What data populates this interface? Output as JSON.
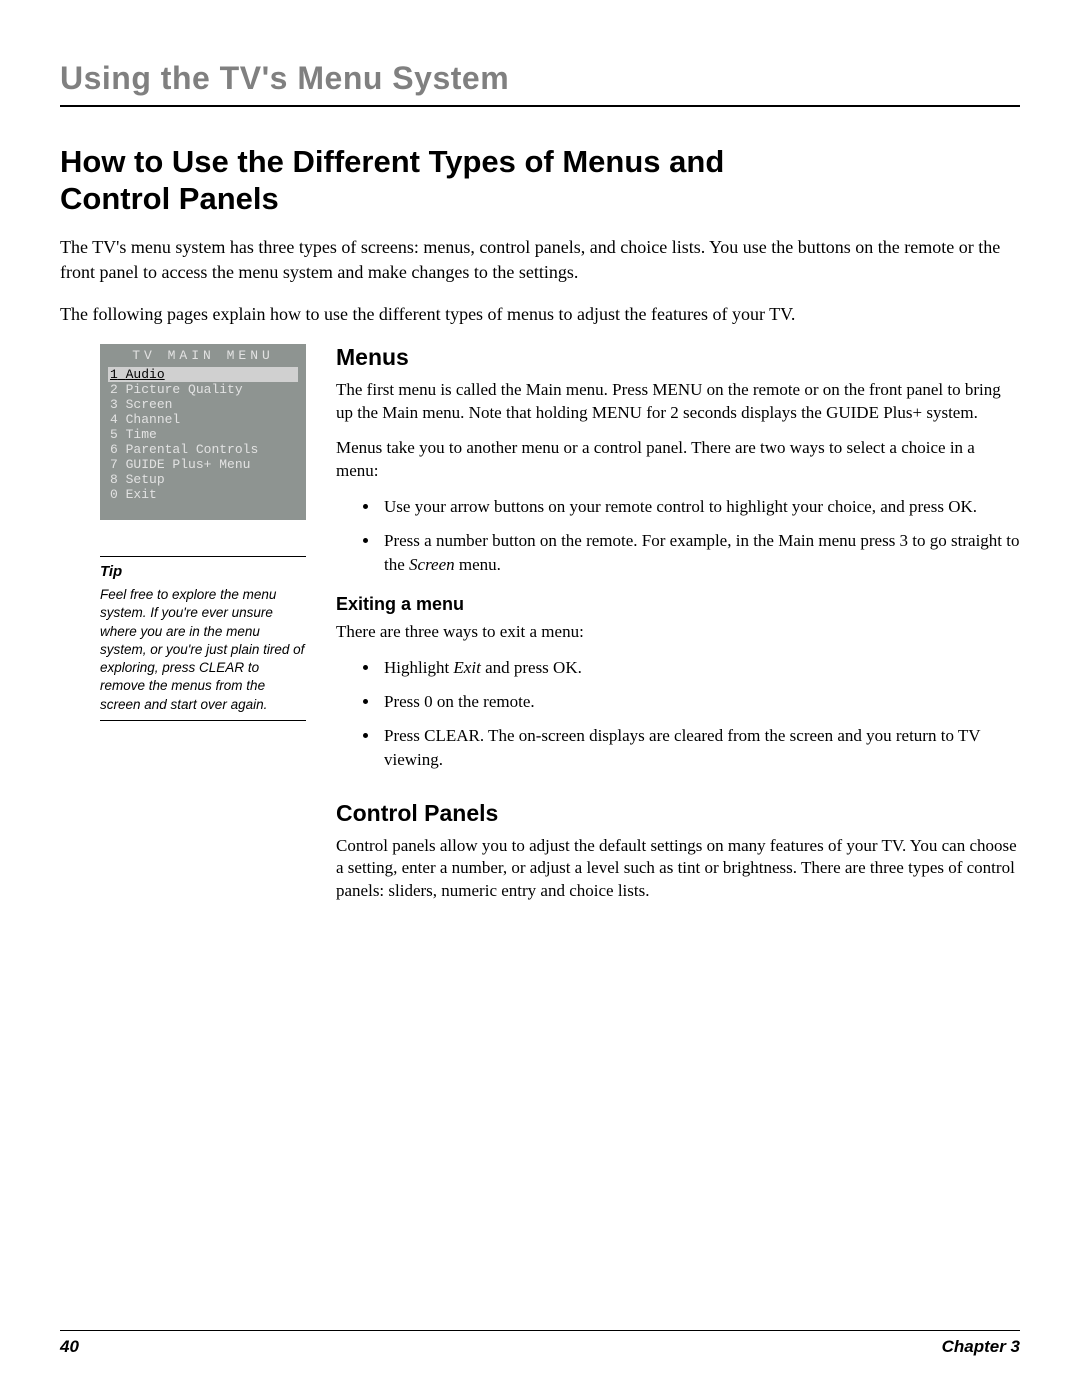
{
  "chapter_title": "Using the TV's Menu System",
  "main_heading": "How to Use the Different Types of Menus and Control Panels",
  "intro_para_1": "The TV's menu system has three types of screens: menus, control panels, and choice lists. You use the buttons on the remote or the front panel to access the menu system and make changes to the settings.",
  "intro_para_2": "The following pages explain how to use the different types of menus to adjust the features of your TV.",
  "tv_menu": {
    "title": "TV MAIN MENU",
    "items": [
      {
        "num": "1",
        "label": "Audio",
        "selected": true
      },
      {
        "num": "2",
        "label": "Picture Quality",
        "selected": false
      },
      {
        "num": "3",
        "label": "Screen",
        "selected": false
      },
      {
        "num": "4",
        "label": "Channel",
        "selected": false
      },
      {
        "num": "5",
        "label": "Time",
        "selected": false
      },
      {
        "num": "6",
        "label": "Parental Controls",
        "selected": false
      },
      {
        "num": "7",
        "label": "GUIDE Plus+ Menu",
        "selected": false
      },
      {
        "num": "8",
        "label": "Setup",
        "selected": false
      },
      {
        "num": "0",
        "label": "Exit",
        "selected": false
      }
    ]
  },
  "tip": {
    "heading": "Tip",
    "body": "Feel free to explore the menu system. If you're ever unsure where you are in the menu system, or you're just plain tired of exploring, press CLEAR to remove the menus from the screen and start over again."
  },
  "menus_section": {
    "heading": "Menus",
    "para_1": "The first menu is called the Main menu. Press MENU on the remote or on the front panel to bring up the Main menu. Note that holding MENU for 2 seconds displays the GUIDE Plus+ system.",
    "para_2": "Menus take you to another menu or a control panel. There are two ways to select a choice in a menu:",
    "bullets": [
      "Use your arrow buttons on your remote control to highlight your choice, and press OK.",
      "Press a number button on the remote. For example, in the Main menu press 3 to go straight to the Screen menu."
    ],
    "bullet2_prefix": "Press a number button on the remote. For example, in the Main menu press 3 to go straight to the ",
    "bullet2_italic": "Screen",
    "bullet2_suffix": " menu."
  },
  "exiting_section": {
    "heading": "Exiting a menu",
    "para": "There are three ways to exit a menu:",
    "bullets": [
      "Highlight Exit and press OK.",
      "Press 0 on the remote.",
      "Press CLEAR. The on-screen displays are cleared from the screen and you return to TV viewing."
    ],
    "bullet1_prefix": "Highlight ",
    "bullet1_italic": "Exit ",
    "bullet1_suffix": "and press OK."
  },
  "control_panels_section": {
    "heading": "Control Panels",
    "para": "Control panels allow you to adjust the default settings on many features of your TV. You can choose a setting, enter a number, or adjust a level such as tint or brightness. There are three types of control panels: sliders, numeric entry and choice lists."
  },
  "footer": {
    "page_number": "40",
    "chapter_label": "Chapter 3"
  }
}
